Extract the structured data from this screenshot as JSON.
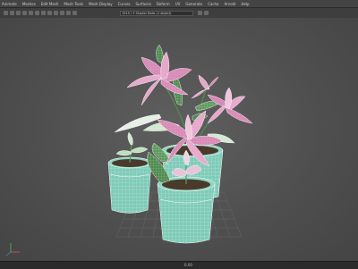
{
  "menubar": {
    "items": [
      "Animate",
      "Meshes",
      "Edit Mesh",
      "Mesh Tools",
      "Mesh Display",
      "Curves",
      "Surfaces",
      "Deform",
      "UV",
      "Generate",
      "Cache",
      "Arnold",
      "Help"
    ]
  },
  "toolbar": {
    "readout": "1515 / 3 Shader Balls (1 object)"
  },
  "viewport": {
    "background_color": "#555555",
    "wireframe_color": "#ffffff",
    "petal_color": "#d78ab6",
    "leaf_color": "#4f8a4f",
    "pot_color": "#7fcbb8",
    "soil_color": "#4a3a2c"
  },
  "statusbar": {
    "frame_label": "0.00"
  }
}
